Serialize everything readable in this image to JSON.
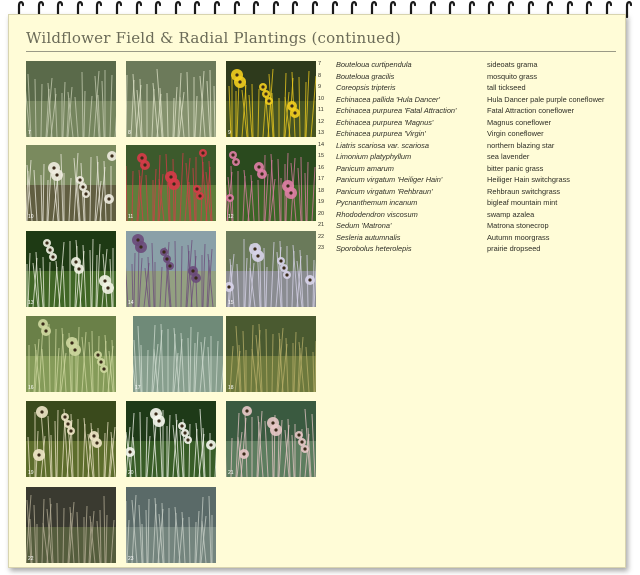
{
  "page": {
    "title": "Wildflower Field & Radial Plantings (continued)"
  },
  "colors": {
    "page_bg": "#fffcd7",
    "title": "#6b6b58",
    "text": "#2e2e26"
  },
  "photos": [
    {
      "num": "7",
      "subject": "sideoats grama grass"
    },
    {
      "num": "8",
      "subject": "mosquito grass"
    },
    {
      "num": "9",
      "subject": "yellow tickseed flowers"
    },
    {
      "num": "10",
      "subject": "white coneflower"
    },
    {
      "num": "11",
      "subject": "red coneflowers"
    },
    {
      "num": "12",
      "subject": "pink coneflowers"
    },
    {
      "num": "13",
      "subject": "white coneflower closeup"
    },
    {
      "num": "14",
      "subject": "blazing star with city skyline"
    },
    {
      "num": "15",
      "subject": "sea lavender"
    },
    {
      "num": "16",
      "subject": "bitter panic grass"
    },
    {
      "num": "17",
      "subject": "switchgrass"
    },
    {
      "num": "18",
      "subject": "switchgrass seedheads"
    },
    {
      "num": "19",
      "subject": "mountain mint"
    },
    {
      "num": "20",
      "subject": "swamp azalea white flowers"
    },
    {
      "num": "21",
      "subject": "stonecrop pink flowerheads"
    },
    {
      "num": "22",
      "subject": "moor grass along rail structure"
    },
    {
      "num": "23",
      "subject": "prairie dropseed"
    }
  ],
  "plants": [
    {
      "num": "7",
      "scientific": "Bouteloua curtipendula",
      "common": "sideoats grama"
    },
    {
      "num": "8",
      "scientific": "Bouteloua gracilis",
      "common": "mosquito grass"
    },
    {
      "num": "9",
      "scientific": "Coreopsis tripteris",
      "common": "tall tickseed"
    },
    {
      "num": "10",
      "scientific": "Echinacea pallida 'Hula Dancer'",
      "common": "Hula Dancer pale purple coneflower"
    },
    {
      "num": "11",
      "scientific": "Echinacea purpurea 'Fatal Attraction'",
      "common": "Fatal Attraction coneflower"
    },
    {
      "num": "12",
      "scientific": "Echinacea purpurea 'Magnus'",
      "common": "Magnus coneflower"
    },
    {
      "num": "13",
      "scientific": "Echinacea purpurea 'Virgin'",
      "common": "Virgin coneflower"
    },
    {
      "num": "14",
      "scientific": "Liatris scariosa var. scariosa",
      "common": "northern blazing star"
    },
    {
      "num": "15",
      "scientific": "Limonium platyphyllum",
      "common": "sea lavender"
    },
    {
      "num": "16",
      "scientific": "Panicum amarum",
      "common": "bitter panic grass"
    },
    {
      "num": "17",
      "scientific": "Panicum virgatum 'Heiliger Hain'",
      "common": "Heiliger Hain switchgrass"
    },
    {
      "num": "18",
      "scientific": "Panicum virgatum 'Rehbraun'",
      "common": "Rehbraun switchgrass"
    },
    {
      "num": "19",
      "scientific": "Pycnanthemum incanum",
      "common": "bigleaf mountain mint"
    },
    {
      "num": "20",
      "scientific": "Rhododendron viscosum",
      "common": "swamp azalea"
    },
    {
      "num": "21",
      "scientific": "Sedum 'Matrona'",
      "common": "Matrona stonecrop"
    },
    {
      "num": "22",
      "scientific": "Sesleria autumnalis",
      "common": "Autumn moorgrass"
    },
    {
      "num": "23",
      "scientific": "Sporobolus heterolepis",
      "common": "prairie dropseed"
    }
  ]
}
